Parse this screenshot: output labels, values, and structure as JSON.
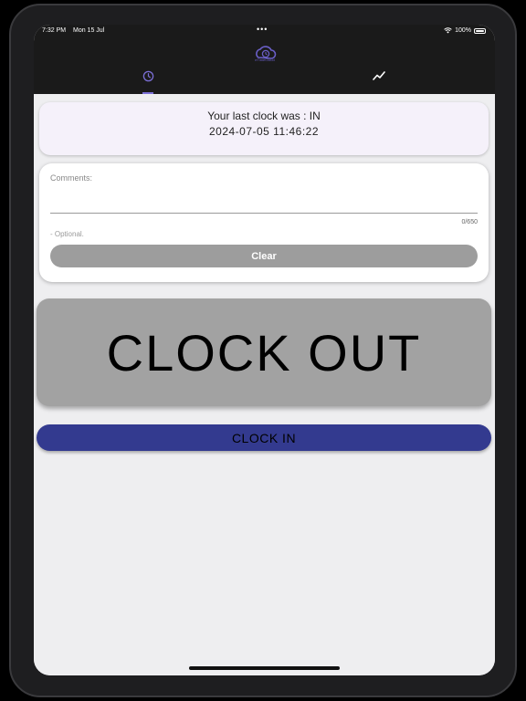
{
  "status_bar": {
    "time": "7:32 PM",
    "date": "Mon 15 Jul",
    "dots": "•••",
    "battery": "100%",
    "icons": [
      "wifi-icon",
      "battery-icon"
    ]
  },
  "header": {
    "logo_icon": "clock-logo-icon",
    "logo_text": "eTimeCloud",
    "accent_color": "#7b6fd6",
    "tabs": [
      {
        "icon": "clock-icon",
        "selected": true
      },
      {
        "icon": "trend-icon",
        "selected": false
      }
    ]
  },
  "last_clock": {
    "line1": "Your last clock was : IN",
    "timestamp": "2024-07-05 11:46:22"
  },
  "comments": {
    "label": "Comments:",
    "value": "",
    "counter": "0/650",
    "helper": "- Optional.",
    "clear_label": "Clear"
  },
  "actions": {
    "clock_out_label": "CLOCK OUT",
    "clock_out_color": "#a2a2a2",
    "clock_in_label": "CLOCK IN",
    "clock_in_color": "#333a8f"
  }
}
